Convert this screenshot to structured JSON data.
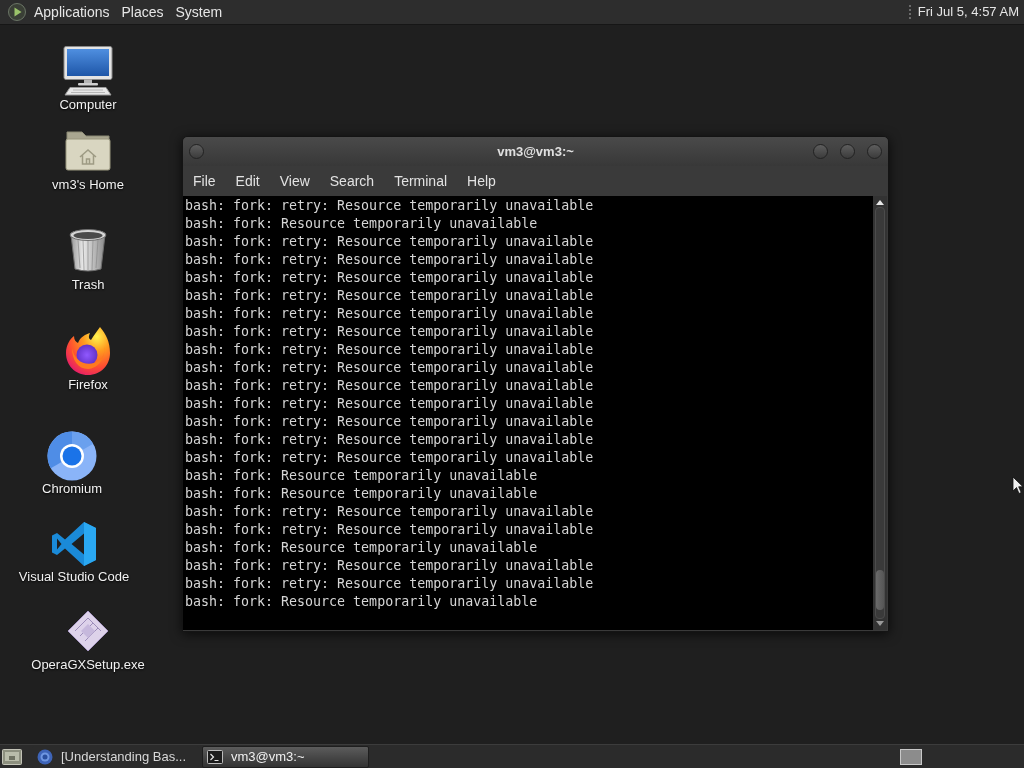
{
  "top_panel": {
    "menus": [
      "Applications",
      "Places",
      "System"
    ],
    "clock": "Fri Jul 5, 4:57 AM"
  },
  "desktop_icons": [
    {
      "kind": "computer",
      "label": "Computer"
    },
    {
      "kind": "home",
      "label": "vm3's Home"
    },
    {
      "kind": "trash",
      "label": "Trash"
    },
    {
      "kind": "firefox",
      "label": "Firefox"
    },
    {
      "kind": "chromium",
      "label": "Chromium"
    },
    {
      "kind": "vscode",
      "label": "Visual Studio Code"
    },
    {
      "kind": "installer",
      "label": "OperaGXSetup.exe"
    }
  ],
  "terminal_window": {
    "title": "vm3@vm3:~",
    "menu": [
      "File",
      "Edit",
      "View",
      "Search",
      "Terminal",
      "Help"
    ],
    "lines": [
      "bash: fork: retry: Resource temporarily unavailable",
      "bash: fork: Resource temporarily unavailable",
      "bash: fork: retry: Resource temporarily unavailable",
      "bash: fork: retry: Resource temporarily unavailable",
      "bash: fork: retry: Resource temporarily unavailable",
      "bash: fork: retry: Resource temporarily unavailable",
      "bash: fork: retry: Resource temporarily unavailable",
      "bash: fork: retry: Resource temporarily unavailable",
      "bash: fork: retry: Resource temporarily unavailable",
      "bash: fork: retry: Resource temporarily unavailable",
      "bash: fork: retry: Resource temporarily unavailable",
      "bash: fork: retry: Resource temporarily unavailable",
      "bash: fork: retry: Resource temporarily unavailable",
      "bash: fork: retry: Resource temporarily unavailable",
      "bash: fork: retry: Resource temporarily unavailable",
      "bash: fork: Resource temporarily unavailable",
      "bash: fork: Resource temporarily unavailable",
      "bash: fork: retry: Resource temporarily unavailable",
      "bash: fork: retry: Resource temporarily unavailable",
      "bash: fork: Resource temporarily unavailable",
      "bash: fork: retry: Resource temporarily unavailable",
      "bash: fork: retry: Resource temporarily unavailable",
      "bash: fork: Resource temporarily unavailable"
    ]
  },
  "taskbar": {
    "windows": [
      {
        "kind": "browser",
        "label": "[Understanding Bas...",
        "selected": false
      },
      {
        "kind": "terminal",
        "label": "vm3@vm3:~",
        "selected": true
      }
    ]
  }
}
